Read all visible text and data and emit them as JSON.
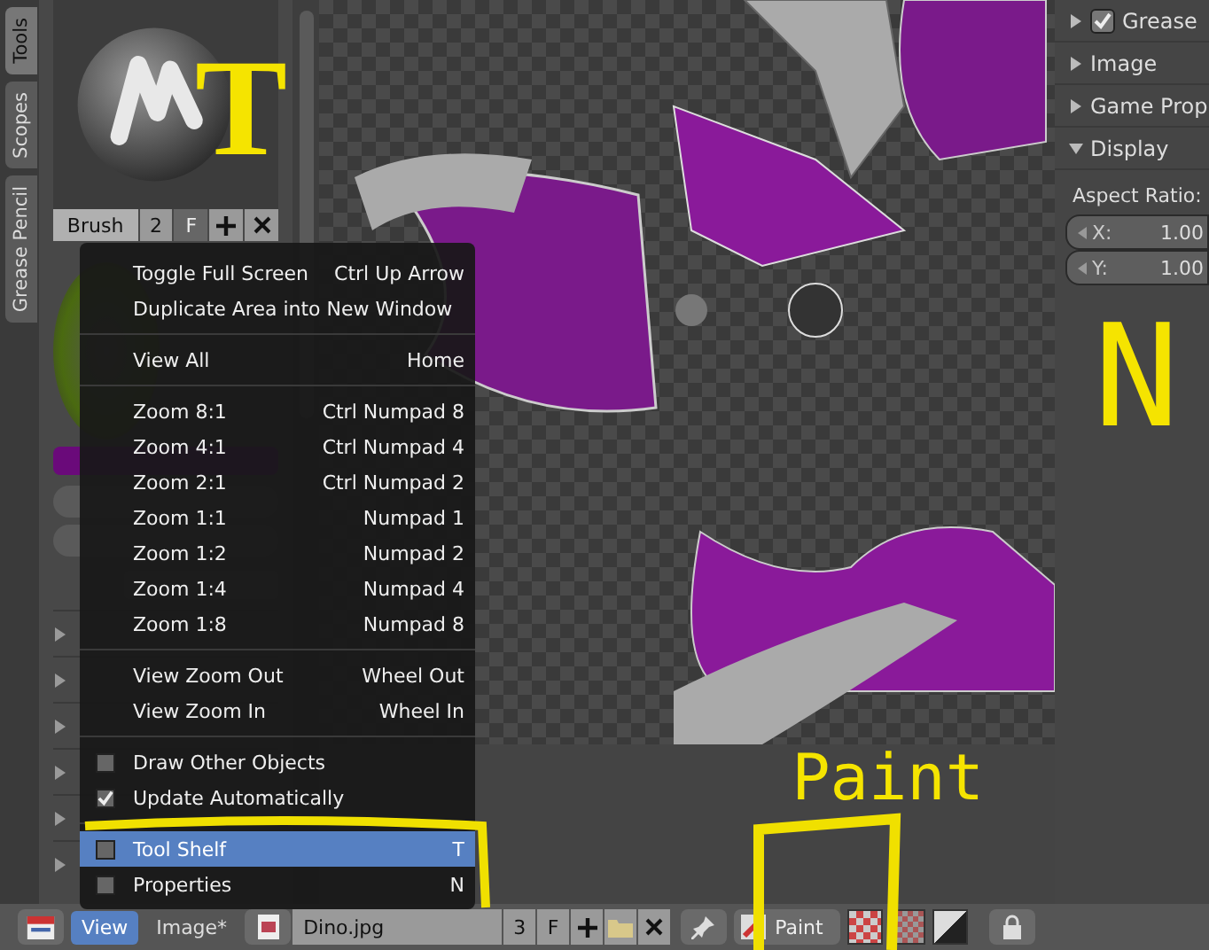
{
  "side_tabs": [
    {
      "label": "Tools",
      "selected": true
    },
    {
      "label": "Scopes",
      "selected": false
    },
    {
      "label": "Grease Pencil",
      "selected": false
    }
  ],
  "tool_shelf": {
    "brush_name": "Brush",
    "brush_users": "2",
    "fake_user": "F",
    "color": "#6a0a7a"
  },
  "annotations": [
    {
      "kind": "letter",
      "text": "T"
    },
    {
      "kind": "letter",
      "text": "N"
    },
    {
      "kind": "word",
      "text": "Paint"
    }
  ],
  "properties": {
    "grease": {
      "label": "Grease",
      "expanded": false,
      "checked": true
    },
    "panels": [
      {
        "label": "Image",
        "expanded": false
      },
      {
        "label": "Game Prop",
        "expanded": false
      },
      {
        "label": "Display",
        "expanded": true
      }
    ],
    "aspect_label": "Aspect Ratio:",
    "aspect": [
      {
        "label": "X:",
        "value": "1.00"
      },
      {
        "label": "Y:",
        "value": "1.00"
      }
    ]
  },
  "view_menu": [
    [
      {
        "kind": "action",
        "label": "Toggle Full Screen",
        "shortcut": "Ctrl Up Arrow",
        "selected": false
      },
      {
        "kind": "action",
        "label": "Duplicate Area into New Window",
        "selected": false
      }
    ],
    [
      {
        "kind": "action",
        "label": "View All",
        "shortcut": "Home",
        "selected": false
      }
    ],
    [
      {
        "kind": "action",
        "label": "Zoom 8:1",
        "shortcut": "Ctrl Numpad 8",
        "selected": false
      },
      {
        "kind": "action",
        "label": "Zoom 4:1",
        "shortcut": "Ctrl Numpad 4",
        "selected": false
      },
      {
        "kind": "action",
        "label": "Zoom 2:1",
        "shortcut": "Ctrl Numpad 2",
        "selected": false
      },
      {
        "kind": "action",
        "label": "Zoom 1:1",
        "shortcut": "Numpad 1",
        "selected": false
      },
      {
        "kind": "action",
        "label": "Zoom 1:2",
        "shortcut": "Numpad 2",
        "selected": false
      },
      {
        "kind": "action",
        "label": "Zoom 1:4",
        "shortcut": "Numpad 4",
        "selected": false
      },
      {
        "kind": "action",
        "label": "Zoom 1:8",
        "shortcut": "Numpad 8",
        "selected": false
      }
    ],
    [
      {
        "kind": "action",
        "label": "View Zoom Out",
        "shortcut": "Wheel Out",
        "selected": false
      },
      {
        "kind": "action",
        "label": "View Zoom In",
        "shortcut": "Wheel In",
        "selected": false
      }
    ],
    [
      {
        "kind": "check",
        "label": "Draw Other Objects",
        "checked": false,
        "selected": false
      },
      {
        "kind": "check",
        "label": "Update Automatically",
        "checked": true,
        "selected": false
      }
    ],
    [
      {
        "kind": "check",
        "label": "Tool Shelf",
        "shortcut": "T",
        "checked": false,
        "selected": true
      },
      {
        "kind": "check",
        "label": "Properties",
        "shortcut": "N",
        "checked": false,
        "selected": false
      }
    ]
  ],
  "header": {
    "menus": [
      {
        "label": "View",
        "selected": true
      },
      {
        "label": "Image*",
        "selected": false
      }
    ],
    "image_name": "Dino.jpg",
    "image_users": "3",
    "fake_user": "F",
    "mode": "Paint"
  }
}
